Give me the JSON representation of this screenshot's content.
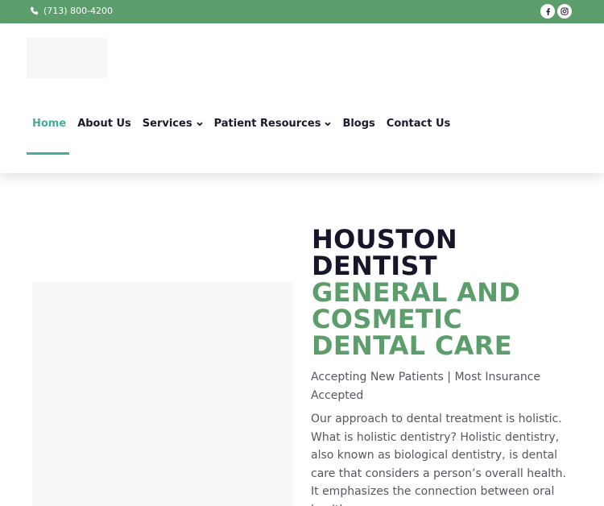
{
  "topbar": {
    "phone": "(713) 800-4200",
    "phone_icon": "phone-icon",
    "social": [
      {
        "icon": "facebook-icon"
      },
      {
        "icon": "instagram-icon"
      }
    ],
    "background_color": "#5c9e6b"
  },
  "nav": {
    "items": [
      {
        "label": "Home",
        "active": true
      },
      {
        "label": "About Us"
      },
      {
        "label": "Services",
        "has_dropdown": true
      },
      {
        "label": "Patient Resources",
        "has_dropdown": true
      },
      {
        "label": "Blogs"
      },
      {
        "label": "Contact Us"
      }
    ],
    "active_color": "#44ae97"
  },
  "hero": {
    "title_line1": "HOUSTON",
    "title_line2": "DENTIST",
    "subtitle_line1": "GENERAL AND",
    "subtitle_line2": "COSMETIC",
    "subtitle_line3": "DENTAL CARE",
    "tagline": "Accepting New Patients | Most Insurance Accepted",
    "body": "Our approach to dental treatment is holistic. What is holistic dentistry?  Holistic dentistry, also known as biological dentistry, is dental care that considers a person’s overall health. It emphasizes the connection between oral health",
    "accent_color": "#5c9e6b"
  }
}
